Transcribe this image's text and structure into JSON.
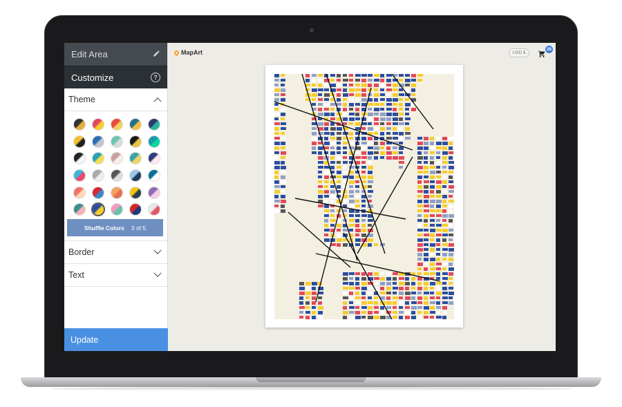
{
  "sidebar": {
    "edit_area_label": "Edit Area",
    "customize_label": "Customize",
    "help_icon_text": "?",
    "theme_label": "Theme",
    "shuffle_label": "Shuffle Colors",
    "shuffle_count": "3 of 5",
    "border_label": "Border",
    "text_label": "Text",
    "update_label": "Update"
  },
  "topbar": {
    "logo_text": "MapArt",
    "currency": "USD $",
    "cart_count": "28"
  },
  "icons": {
    "edit": "pencil-icon",
    "help": "help-icon",
    "theme_toggle": "chevron-up-icon",
    "border_toggle": "chevron-down-icon",
    "text_toggle": "chevron-down-icon",
    "logo": "map-pin-icon",
    "cart": "cart-icon"
  },
  "colors": {
    "sidebar_dark": "#2b3034",
    "accent_blue": "#4a90e2",
    "shuffle_blue": "#6f8fc2",
    "map_land": "#f3efe1",
    "map_palette": [
      "#2b4ea2",
      "#f6cd2c",
      "#e5485b",
      "#8fa0c8",
      "#ffffff",
      "#555555"
    ]
  },
  "theme_swatches": [
    [
      "#333333",
      "#e8b040"
    ],
    [
      "#e5485b",
      "#f6cd2c"
    ],
    [
      "#e84c3d",
      "#f0d060"
    ],
    [
      "#1f6f8b",
      "#f0c040"
    ],
    [
      "#2a3b6c",
      "#2bb3a0"
    ],
    [
      "#f2c12e",
      "#222222"
    ],
    [
      "#2a6fb0",
      "#c0c6d0"
    ],
    [
      "#6cc2b5",
      "#d9d9d9"
    ],
    [
      "#1a1a1a",
      "#e6c542"
    ],
    [
      "#1b9aaa",
      "#06d6a0"
    ],
    [
      "#222222",
      "#f5f5f5"
    ],
    [
      "#27a3b4",
      "#f4e04d"
    ],
    [
      "#c9a0a0",
      "#f6f0ea"
    ],
    [
      "#3aa6a6",
      "#f0d36a"
    ],
    [
      "#2f3c7e",
      "#fbeaeb"
    ],
    [
      "#3cb4d8",
      "#ef476f"
    ],
    [
      "#aaaaaa",
      "#eeeeee"
    ],
    [
      "#555555",
      "#dddddd"
    ],
    [
      "#9ac7e8",
      "#1f3a5f"
    ],
    [
      "#0b6e99",
      "#ffffff"
    ],
    [
      "#f07167",
      "#fed9b7"
    ],
    [
      "#d72638",
      "#3f88c5"
    ],
    [
      "#f4a261",
      "#e76f51"
    ],
    [
      "#f1c40f",
      "#2c3e50"
    ],
    [
      "#8e6ab8",
      "#f5d0e0"
    ],
    [
      "#3b8e8e",
      "#f7b2b7"
    ],
    [
      "#2b4ea2",
      "#f6cd2c"
    ],
    [
      "#f49ac2",
      "#66c2a5"
    ],
    [
      "#d62728",
      "#1f3b7a"
    ],
    [
      "#e8e8e8",
      "#e05a6a"
    ]
  ],
  "selected_swatch_index": 26
}
